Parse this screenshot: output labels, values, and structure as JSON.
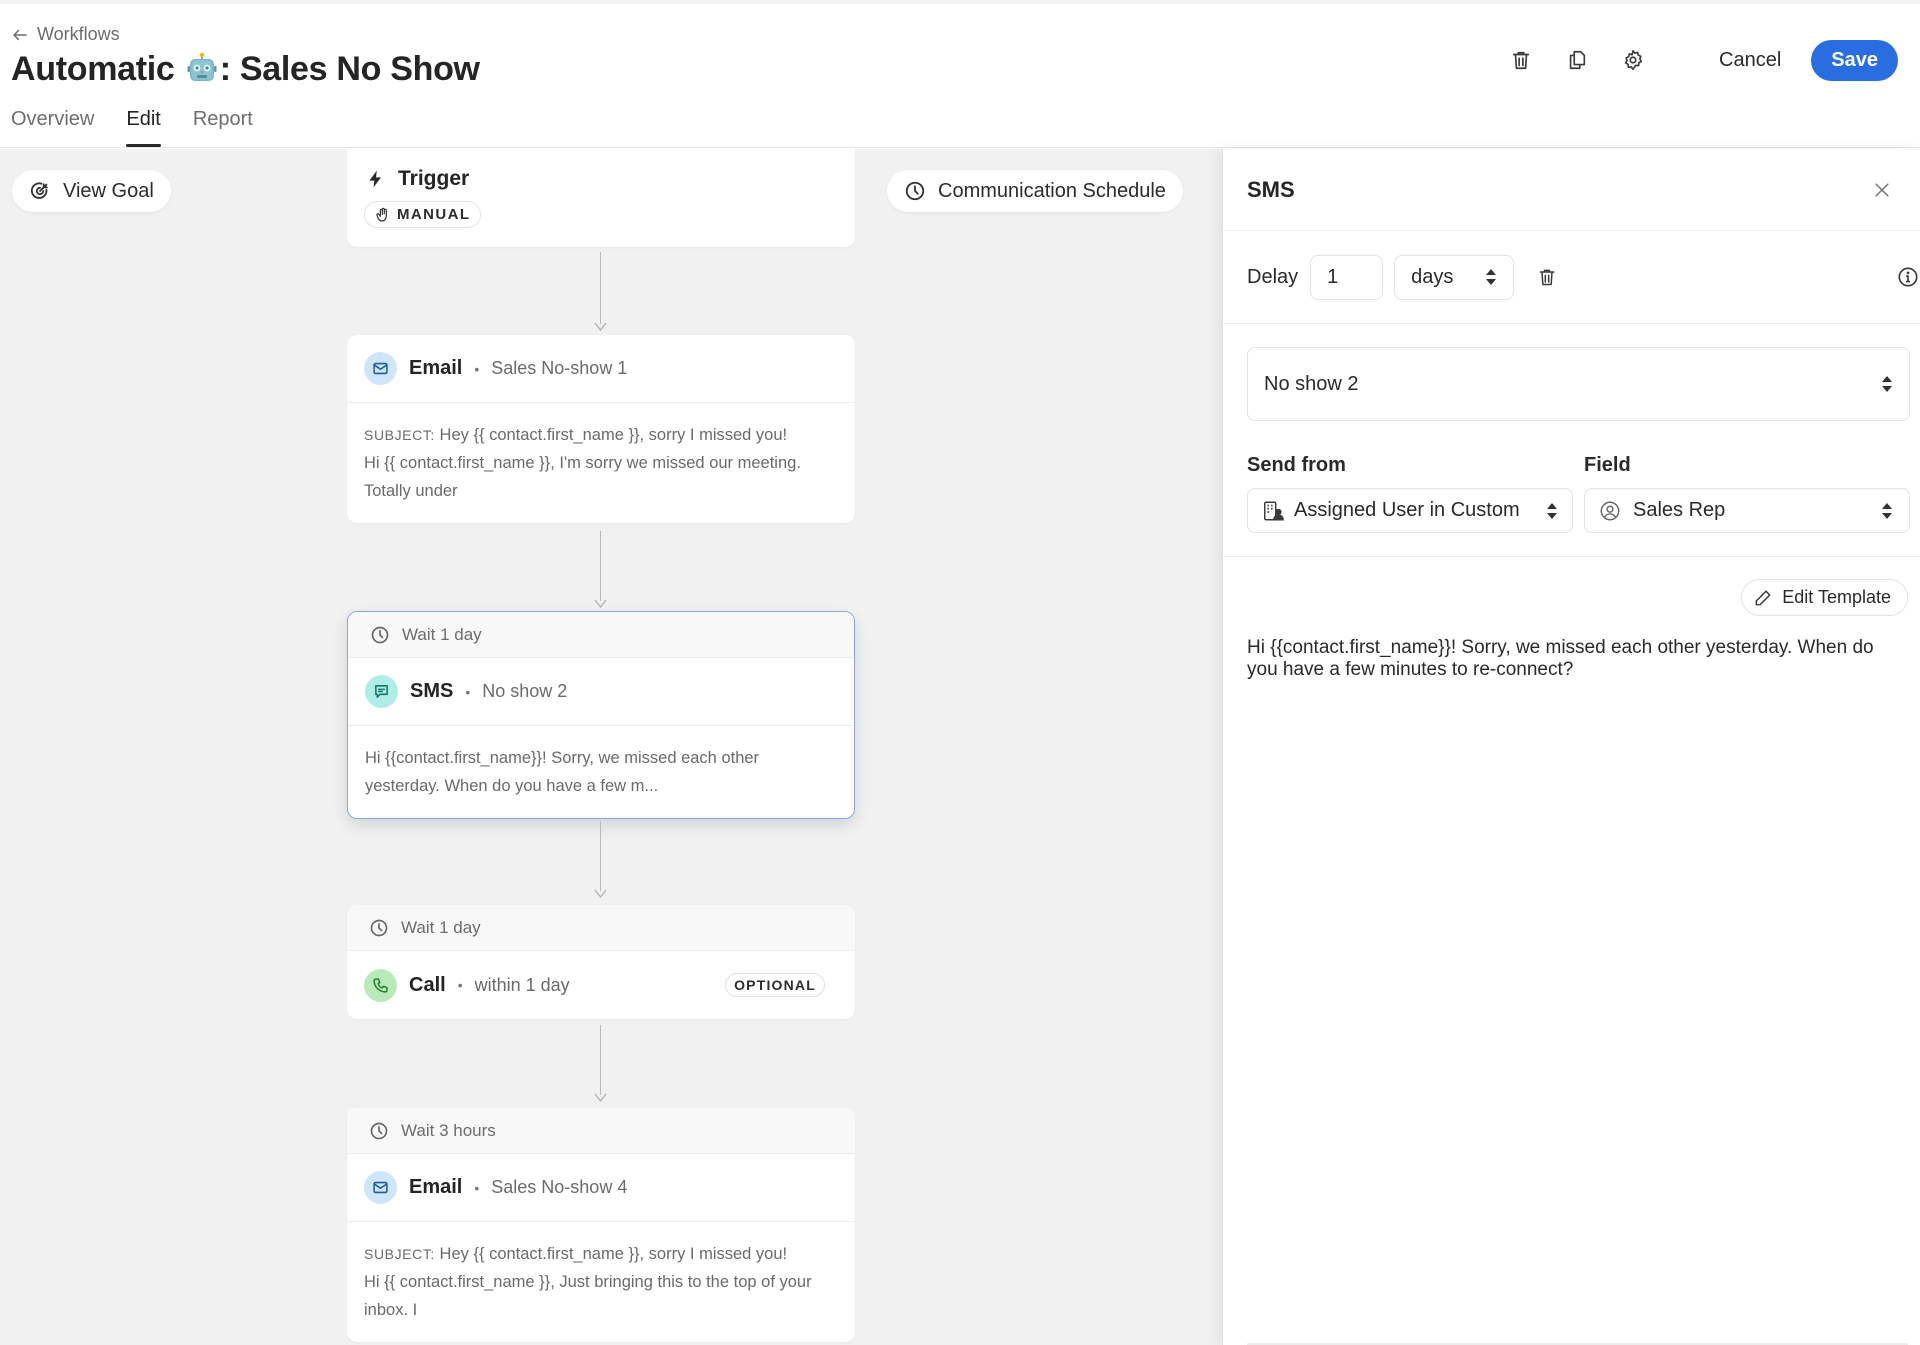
{
  "header": {
    "breadcrumb": "Workflows",
    "title_prefix": "Automatic",
    "title_emoji": "robot",
    "title_suffix": ": Sales No Show",
    "tabs": [
      {
        "label": "Overview",
        "active": false
      },
      {
        "label": "Edit",
        "active": true
      },
      {
        "label": "Report",
        "active": false
      }
    ],
    "actions": {
      "delete_icon": "trash-icon",
      "duplicate_icon": "copy-icon",
      "settings_icon": "gear-icon",
      "cancel_label": "Cancel",
      "save_label": "Save"
    },
    "accent_color": "#2a6de1"
  },
  "canvas": {
    "view_goal_label": "View Goal",
    "communication_schedule_label": "Communication Schedule",
    "trigger": {
      "title": "Trigger",
      "chip": "MANUAL"
    },
    "steps": [
      {
        "wait": null,
        "type": "Email",
        "name": "Sales No-show 1",
        "subject_label": "SUBJECT:",
        "subject": "Hey {{ contact.first_name }}, sorry I missed you!",
        "body": "Hi {{ contact.first_name }}, I'm sorry we missed our meeting. Totally under"
      },
      {
        "wait": "Wait 1 day",
        "type": "SMS",
        "name": "No show 2",
        "body": "Hi {{contact.first_name}}! Sorry, we missed each other yesterday. When do you have a few m...",
        "selected": true
      },
      {
        "wait": "Wait 1 day",
        "type": "Call",
        "name": "within 1 day",
        "badge": "OPTIONAL"
      },
      {
        "wait": "Wait 3 hours",
        "type": "Email",
        "name": "Sales No-show 4",
        "subject_label": "SUBJECT:",
        "subject": "Hey {{ contact.first_name }}, sorry I missed you!",
        "body": "Hi {{ contact.first_name }}, Just bringing this to the top of your inbox. I"
      }
    ]
  },
  "panel": {
    "title": "SMS",
    "delay_label": "Delay",
    "delay_value": "1",
    "delay_unit": "days",
    "template_selected": "No show 2",
    "send_from_label": "Send from",
    "send_from_value": "Assigned User in Custom",
    "field_label": "Field",
    "field_value": "Sales Rep",
    "edit_template_label": "Edit Template",
    "message": "Hi {{contact.first_name}}! Sorry, we missed each other yesterday. When do you have a few minutes to re-connect?"
  }
}
